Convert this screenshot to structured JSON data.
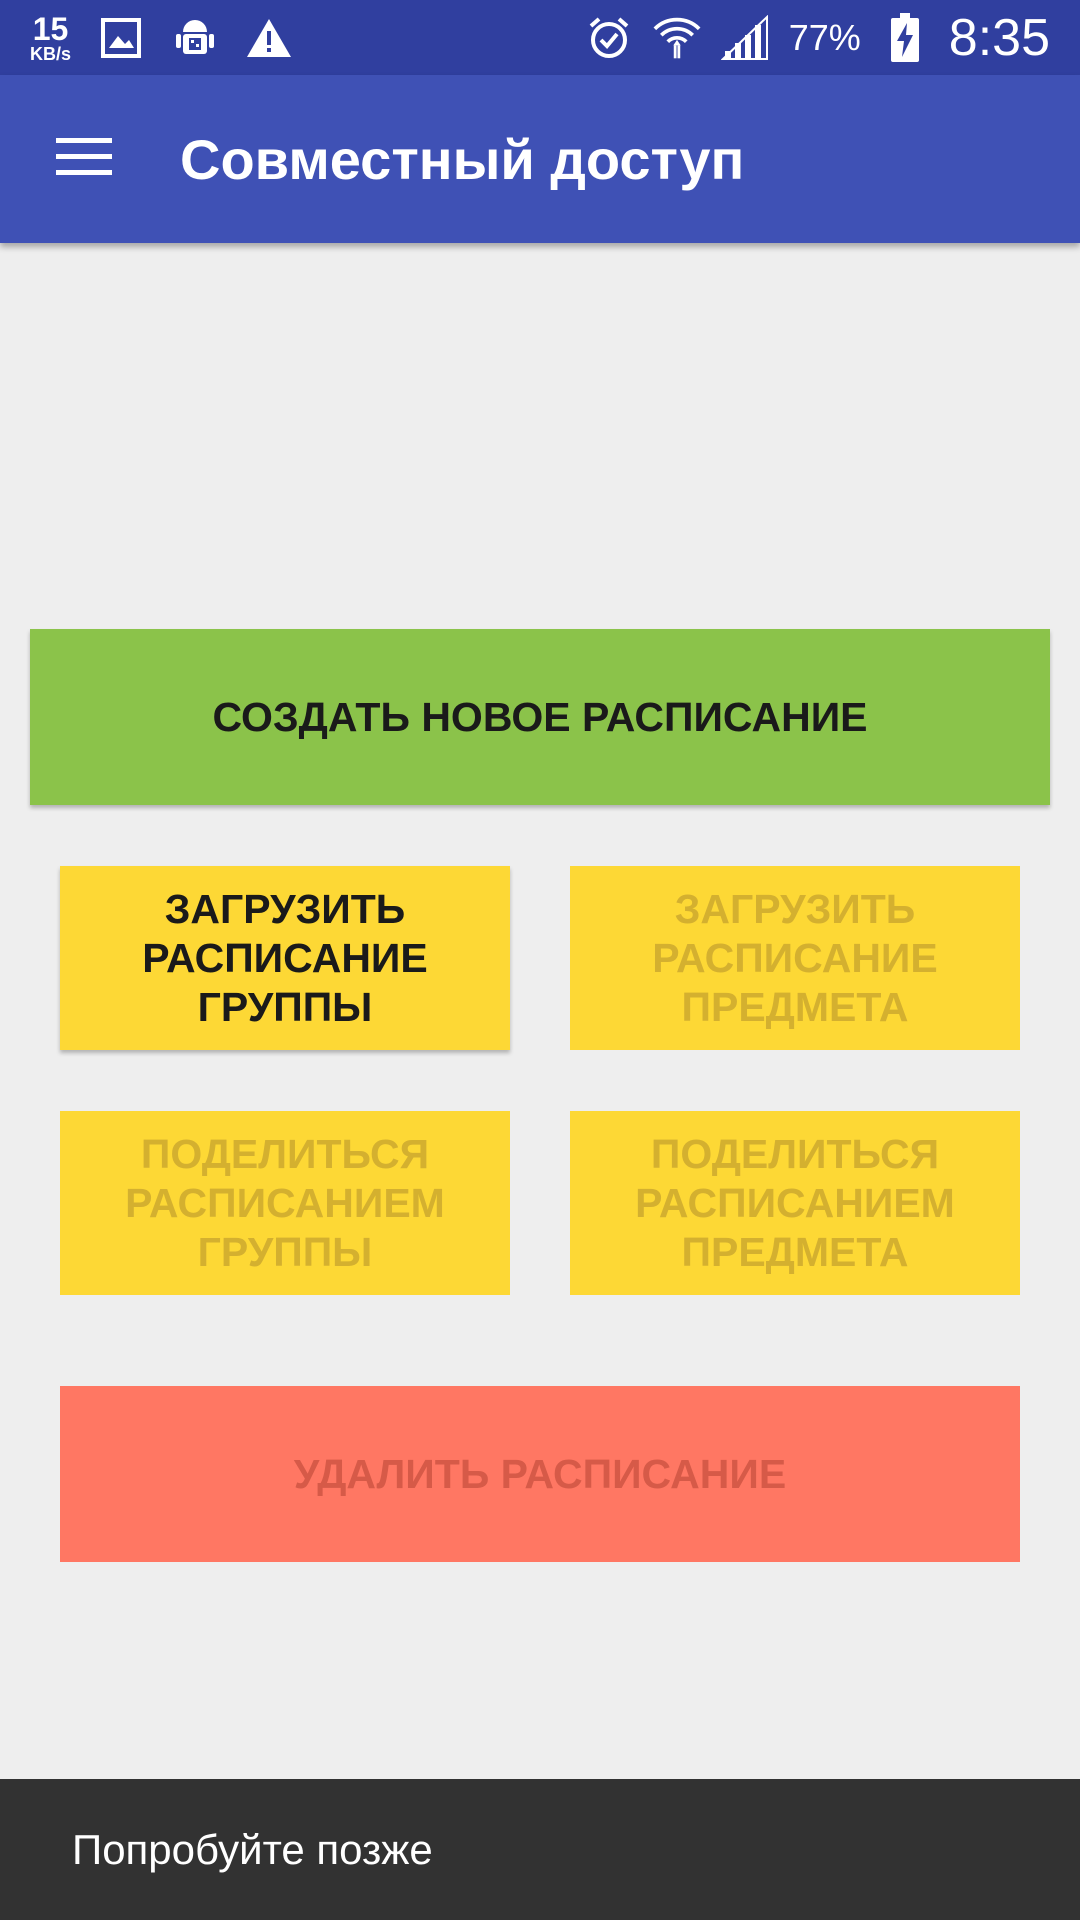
{
  "status_bar": {
    "net_speed": "15",
    "net_unit": "KB/s",
    "battery": "77%",
    "time": "8:35",
    "icons_left": [
      "image-icon",
      "android-debug-icon",
      "warning-icon"
    ],
    "icons_right": [
      "alarm-icon",
      "wifi-icon",
      "signal-icon",
      "battery-charging-icon"
    ]
  },
  "app_bar": {
    "title": "Совместный доступ",
    "menu_icon": "menu-icon"
  },
  "colors": {
    "status_bar": "#303f9f",
    "app_bar": "#3f51b5",
    "create_button": "#8bc34a",
    "yellow_button": "#fdd835",
    "delete_button": "#ff7763",
    "snackbar": "#323232"
  },
  "buttons": {
    "create": "СОЗДАТЬ НОВОЕ РАСПИСАНИЕ",
    "load_group": "ЗАГРУЗИТЬ\nРАСПИСАНИЕ\nГРУППЫ",
    "load_subject": "ЗАГРУЗИТЬ\nРАСПИСАНИЕ\nПРЕДМЕТА",
    "share_group": "ПОДЕЛИТЬСЯ\nРАСПИСАНИЕМ\nГРУППЫ",
    "share_subject": "ПОДЕЛИТЬСЯ\nРАСПИСАНИЕМ\nПРЕДМЕТА",
    "delete": "УДАЛИТЬ РАСПИСАНИЕ"
  },
  "snackbar": {
    "message": "Попробуйте позже"
  }
}
